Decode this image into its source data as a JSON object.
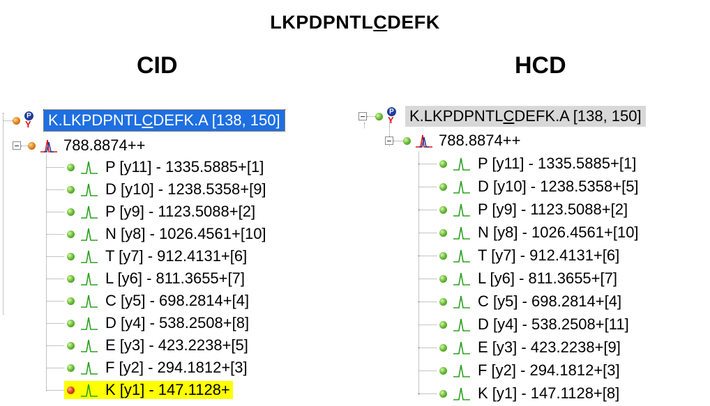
{
  "title": {
    "prefix": "LKPDPNTL",
    "underlined": "C",
    "suffix": "DEFK"
  },
  "cid": {
    "heading": "CID",
    "peptide": {
      "prefix": "K.LKPDPNTL",
      "underlined": "C",
      "suffix": "DEFK.A [138, 150]"
    },
    "precursor": "788.8874++",
    "fragments": [
      {
        "text": "P [y11] - 1335.5885+[1]",
        "status": "green"
      },
      {
        "text": "D [y10] - 1238.5358+[9]",
        "status": "green"
      },
      {
        "text": "P [y9] - 1123.5088+[2]",
        "status": "green"
      },
      {
        "text": "N [y8] - 1026.4561+[10]",
        "status": "green"
      },
      {
        "text": "T [y7] - 912.4131+[6]",
        "status": "green"
      },
      {
        "text": "L [y6] - 811.3655+[7]",
        "status": "green"
      },
      {
        "text": "C [y5] - 698.2814+[4]",
        "status": "green"
      },
      {
        "text": "D [y4] - 538.2508+[8]",
        "status": "green"
      },
      {
        "text": "E [y3] - 423.2238+[5]",
        "status": "green"
      },
      {
        "text": "F [y2] - 294.1812+[3]",
        "status": "green"
      },
      {
        "text": "K [y1] - 147.1128+",
        "status": "red",
        "highlight": true
      }
    ]
  },
  "hcd": {
    "heading": "HCD",
    "peptide": {
      "prefix": "K.LKPDPNTL",
      "underlined": "C",
      "suffix": "DEFK.A [138, 150]"
    },
    "precursor": "788.8874++",
    "fragments": [
      {
        "text": "P [y11] - 1335.5885+[1]",
        "status": "green"
      },
      {
        "text": "D [y10] - 1238.5358+[5]",
        "status": "green"
      },
      {
        "text": "P [y9] - 1123.5088+[2]",
        "status": "green"
      },
      {
        "text": "N [y8] - 1026.4561+[10]",
        "status": "green"
      },
      {
        "text": "T [y7] - 912.4131+[6]",
        "status": "green"
      },
      {
        "text": "L [y6] - 811.3655+[7]",
        "status": "green"
      },
      {
        "text": "C [y5] - 698.2814+[4]",
        "status": "green"
      },
      {
        "text": "D [y4] - 538.2508+[11]",
        "status": "green"
      },
      {
        "text": "E [y3] - 423.2238+[9]",
        "status": "green"
      },
      {
        "text": "F [y2] - 294.1812+[3]",
        "status": "green"
      },
      {
        "text": "K [y1] - 147.1128+[8]",
        "status": "green"
      }
    ]
  },
  "colors": {
    "selection_blue": "#1e6fe0",
    "selection_grey": "#d8d8d8",
    "highlight_yellow": "#ffff00",
    "peak_green": "#2aa01e",
    "peak_red": "#e01010",
    "peak_blue": "#1f3d9c"
  },
  "icons": {
    "ion_dot": "green-sphere-icon",
    "precursor_dot": "orange-sphere-icon",
    "unmatched_dot": "red-sphere-icon",
    "peak": "spectrum-peak-icon",
    "protein": "py-modification-icon",
    "expander": "collapse-minus-icon"
  }
}
